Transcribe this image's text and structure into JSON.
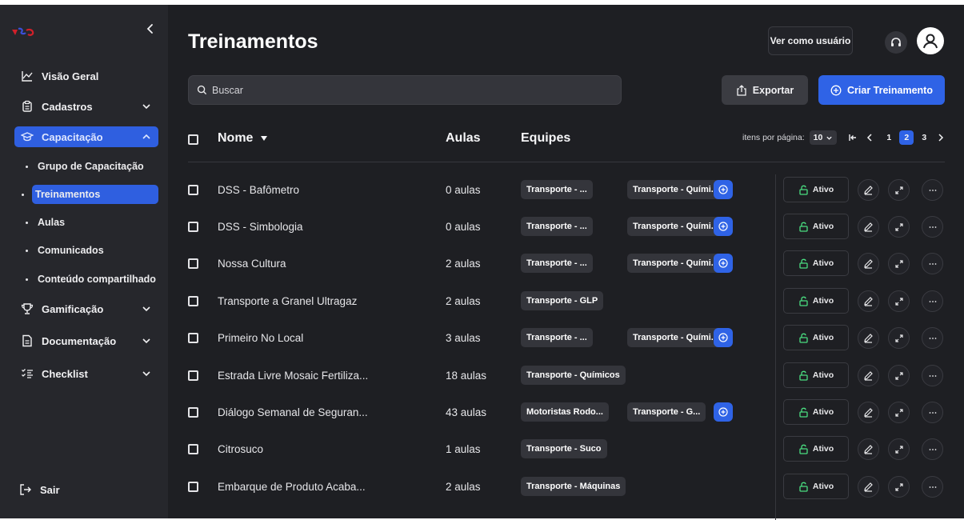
{
  "sidebar": {
    "nav": [
      {
        "label": "Visão Geral",
        "icon": "chart-line-icon"
      },
      {
        "label": "Cadastros",
        "icon": "clipboard-icon"
      },
      {
        "label": "Capacitação",
        "icon": "graduation-cap-icon"
      },
      {
        "label": "Gamificação",
        "icon": "trophy-icon"
      },
      {
        "label": "Documentação",
        "icon": "document-icon"
      },
      {
        "label": "Checklist",
        "icon": "checklist-icon"
      }
    ],
    "sub": [
      "Grupo de Capacitação",
      "Treinamentos",
      "Aulas",
      "Comunicados",
      "Conteúdo compartilhado"
    ],
    "logout": "Sair"
  },
  "header": {
    "title": "Treinamentos",
    "view_as_user": "Ver como usuário",
    "search_placeholder": "Buscar",
    "export": "Exportar",
    "create": "Criar Treinamento"
  },
  "table": {
    "headers": {
      "name": "Nome",
      "aulas": "Aulas",
      "equipes": "Equipes"
    },
    "pager": {
      "label": "itens por página:",
      "per_page": "10",
      "pages": [
        "1",
        "2",
        "3"
      ],
      "current": "2"
    },
    "rows": [
      {
        "name": "DSS - Bafômetro",
        "aulas": "0 aulas",
        "tags": [
          "Transporte - ...",
          "Transporte - Quími..."
        ],
        "more": true,
        "status": "Ativo"
      },
      {
        "name": "DSS - Simbologia",
        "aulas": "0 aulas",
        "tags": [
          "Transporte - ...",
          "Transporte - Quími..."
        ],
        "more": true,
        "status": "Ativo"
      },
      {
        "name": "Nossa Cultura",
        "aulas": "2 aulas",
        "tags": [
          "Transporte - ...",
          "Transporte - Quími..."
        ],
        "more": true,
        "status": "Ativo"
      },
      {
        "name": "Transporte a Granel Ultragaz",
        "aulas": "2 aulas",
        "tags": [
          "Transporte - GLP"
        ],
        "more": false,
        "status": "Ativo"
      },
      {
        "name": "Primeiro No Local",
        "aulas": "3 aulas",
        "tags": [
          "Transporte - ...",
          "Transporte - Quími..."
        ],
        "more": true,
        "status": "Ativo"
      },
      {
        "name": "Estrada Livre Mosaic Fertiliza...",
        "aulas": "18 aulas",
        "tags": [
          "Transporte - Químicos"
        ],
        "more": false,
        "status": "Ativo"
      },
      {
        "name": "Diálogo Semanal de Seguran...",
        "aulas": "43 aulas",
        "tags": [
          "Motoristas Rodo...",
          "Transporte - G..."
        ],
        "more": true,
        "status": "Ativo"
      },
      {
        "name": "Citrosuco",
        "aulas": "1 aulas",
        "tags": [
          "Transporte - Suco"
        ],
        "more": false,
        "status": "Ativo"
      },
      {
        "name": "Embarque de Produto Acaba...",
        "aulas": "2 aulas",
        "tags": [
          "Transporte - Máquinas"
        ],
        "more": false,
        "status": "Ativo"
      }
    ]
  },
  "colors": {
    "accent": "#2f63e6",
    "sidebar_bg": "#26272c",
    "main_bg": "#1e1f23",
    "status_green": "#4ade80"
  }
}
